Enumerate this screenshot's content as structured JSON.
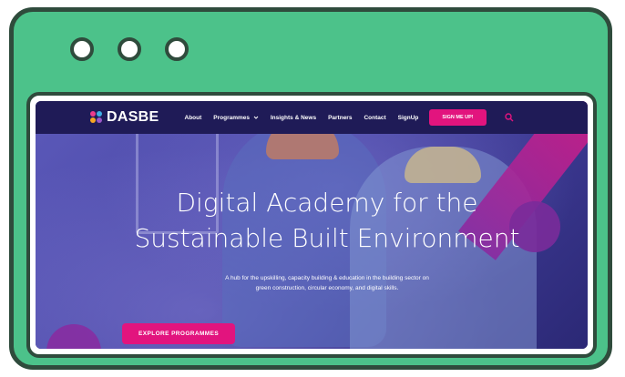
{
  "window": {
    "controls": [
      "window-dot-icon",
      "window-dot-icon",
      "window-dot-icon"
    ]
  },
  "site": {
    "logo_text": "DASBE",
    "nav": {
      "about": "About",
      "programmes": "Programmes",
      "insights": "Insights & News",
      "partners": "Partners",
      "contact": "Contact",
      "signup": "SignUp"
    },
    "signup_button": "SIGN ME UP!",
    "hero": {
      "title_line1": "Digital Academy for the",
      "title_line2": "Sustainable Built Environment",
      "subtitle": "A hub for the upskilling, capacity building & education in the building sector on green construction, circular economy, and digital skills.",
      "cta": "EXPLORE PROGRAMMES"
    },
    "colors": {
      "accent": "#e2147e",
      "navy": "#1f1b57",
      "frame_green": "#4cc28a",
      "frame_outline": "#2f4b3c"
    }
  }
}
